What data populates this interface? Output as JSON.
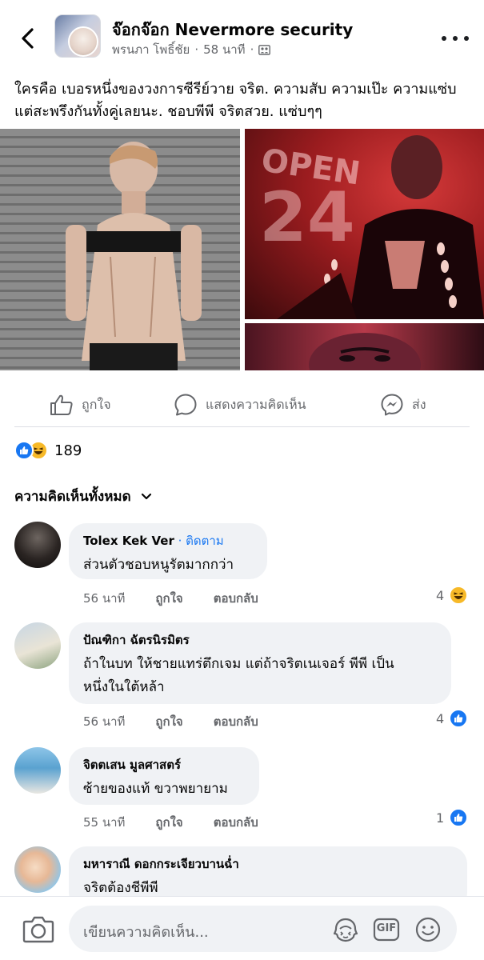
{
  "header": {
    "group_name": "จ๊อกจ๊อก Nevermore security",
    "author": "พรนภา โพธิ์ชัย",
    "separator": "·",
    "time": "58 นาที",
    "separator2": "·"
  },
  "post": {
    "text": "ใครคือ เบอรหนึ่งของวงการซีรีย์วาย จริต. ความสับ ความเป๊ะ ความแซ่บ  แต่สะพรึงกันทั้งคู่เลยนะ. ชอบพีพี จริตสวย. แซ่บๆๆ"
  },
  "actions": {
    "like": "ถูกใจ",
    "comment": "แสดงความคิดเห็น",
    "share": "ส่ง"
  },
  "reactions": {
    "count": "189"
  },
  "comments_header": "ความคิดเห็นทั้งหมด",
  "comments": [
    {
      "name": "Tolex Kek Ver",
      "follow": " · ติดตาม",
      "text": "ส่วนตัวชอบหนูรัตมากกว่า",
      "time": "56 นาที",
      "like": "ถูกใจ",
      "reply": "ตอบกลับ",
      "reaction_count": "4",
      "reaction_type": "haha"
    },
    {
      "name": "ปัณฑิกา ฉัตรนิรมิตร",
      "text_line1": "ถ้าในบท ให้ชายแทร่ตึกเจม แต่ถ้าจริตเนเจอร์ พีพี เป็น",
      "text_line2": "หนึ่งในใต้หล้า",
      "time": "56 นาที",
      "like": "ถูกใจ",
      "reply": "ตอบกลับ",
      "reaction_count": "4",
      "reaction_type": "like"
    },
    {
      "name": "จิตตเสน มูลศาสตร์",
      "text": "ซ้ายของแท้ ขวาพยายาม",
      "time": "55 นาที",
      "like": "ถูกใจ",
      "reply": "ตอบกลับ",
      "reaction_count": "1",
      "reaction_type": "like"
    },
    {
      "name": "มหาราณี ดอกกระเจียวบานฉ่ำ",
      "text": "จริตต้องชีพีพี"
    }
  ],
  "composer": {
    "placeholder": "เขียนความคิดเห็น...",
    "gif_label": "GIF"
  },
  "colors": {
    "accent": "#1877f2",
    "bubble": "#f0f2f5",
    "muted_text": "#65676b"
  },
  "icons": [
    "back-arrow-icon",
    "more-icon",
    "privacy-group-icon",
    "like-icon",
    "comment-icon",
    "messenger-icon",
    "chevron-down-icon",
    "camera-icon",
    "avatar-sticker-icon",
    "gif-icon",
    "emoji-icon"
  ]
}
